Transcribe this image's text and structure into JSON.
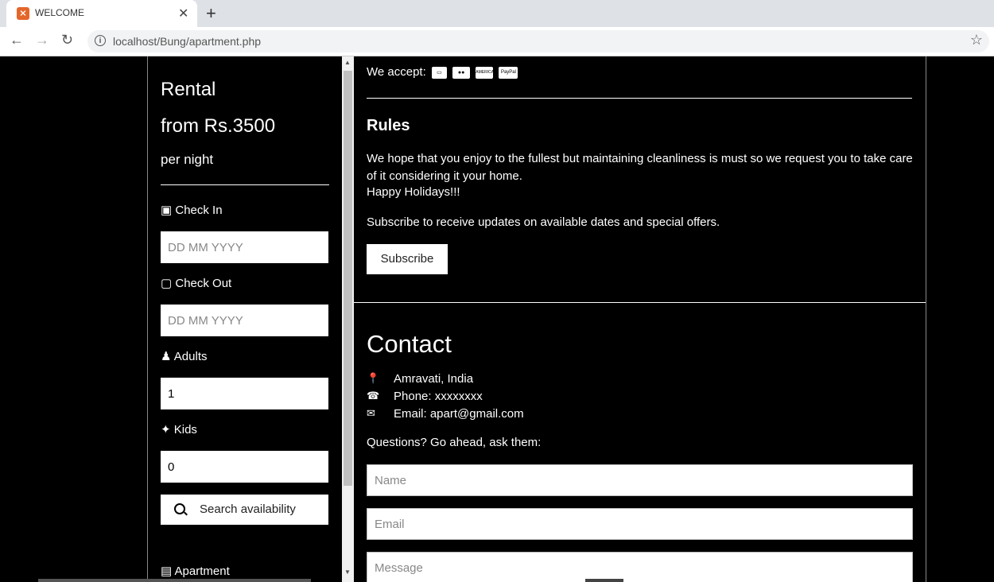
{
  "browser": {
    "tab_title": "WELCOME",
    "url": "localhost/Bung/apartment.php"
  },
  "rental": {
    "title": "Rental",
    "price": "from Rs.3500",
    "unit": "per night"
  },
  "booking": {
    "checkin_label": "Check In",
    "checkin_placeholder": "DD MM YYYY",
    "checkout_label": "Check Out",
    "checkout_placeholder": "DD MM YYYY",
    "adults_label": "Adults",
    "adults_value": "1",
    "kids_label": "Kids",
    "kids_value": "0",
    "search_label": "Search availability",
    "apartment_label": "Apartment"
  },
  "payment": {
    "label": "We accept:",
    "cards": [
      "credit-card-icon",
      "mastercard-icon",
      "amex-icon",
      "paypal-icon"
    ],
    "amex_text": "AMERICAN EXPRESS",
    "paypal_text": "PayPal"
  },
  "rules": {
    "title": "Rules",
    "text": "We hope that you enjoy to the fullest but maintaining cleanliness is must so we request you to take care of it considering it your home.",
    "happy": "Happy Holidays!!!",
    "subscribe_text": "Subscribe to receive updates on available dates and special offers.",
    "subscribe_button": "Subscribe"
  },
  "contact": {
    "title": "Contact",
    "location": "Amravati, India",
    "phone": "Phone: xxxxxxxx",
    "email": "Email: apart@gmail.com",
    "questions": "Questions? Go ahead, ask them:",
    "name_placeholder": "Name",
    "email_placeholder": "Email",
    "message_placeholder": "Message"
  },
  "colors": {
    "page_bg": "#000000",
    "text": "#ffffff",
    "favicon": "#e4662a"
  }
}
